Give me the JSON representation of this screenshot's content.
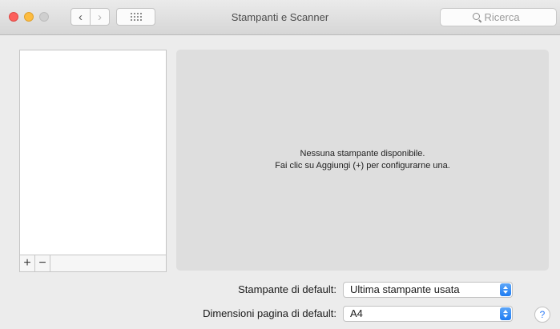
{
  "window": {
    "title": "Stampanti e Scanner",
    "nav_back_icon": "chevron-left-icon",
    "nav_forward_icon": "chevron-right-icon",
    "show_all_icon": "grid-icon"
  },
  "search": {
    "placeholder": "Ricerca",
    "value": ""
  },
  "printer_list": {
    "items": [],
    "add_label": "+",
    "remove_label": "−"
  },
  "detail": {
    "empty_line1": "Nessuna stampante disponibile.",
    "empty_line2": "Fai clic su Aggiungi (+) per configurarne una."
  },
  "defaults": {
    "printer_label": "Stampante di default:",
    "printer_value": "Ultima stampante usata",
    "paper_label": "Dimensioni pagina di default:",
    "paper_value": "A4"
  },
  "help": {
    "label": "?"
  },
  "colors": {
    "close": "#fc605c",
    "minimize": "#fdbc40",
    "zoom_inactive": "#cfcfcf",
    "accent": "#1f7cf2"
  }
}
